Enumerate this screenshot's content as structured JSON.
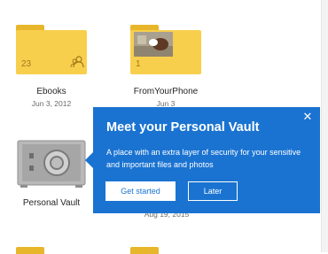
{
  "files": [
    {
      "name": "Ebooks",
      "date": "Jun 3, 2012",
      "count": "23",
      "icon": "shared-people-icon"
    },
    {
      "name": "FromYourPhone",
      "date": "Jun 3",
      "count": "1",
      "icon": "photo-thumbnail"
    },
    {
      "name": "Personal Vault",
      "date": "",
      "icon": "vault-safe-icon"
    },
    {
      "name": "",
      "date": "Aug 19, 2015"
    }
  ],
  "callout": {
    "title": "Meet your Personal Vault",
    "body": "A place with an extra layer of security for your sensitive and important files and photos",
    "primary_button": "Get started",
    "secondary_button": "Later",
    "close_icon": "close-icon",
    "accent_color": "#1a73d1"
  }
}
